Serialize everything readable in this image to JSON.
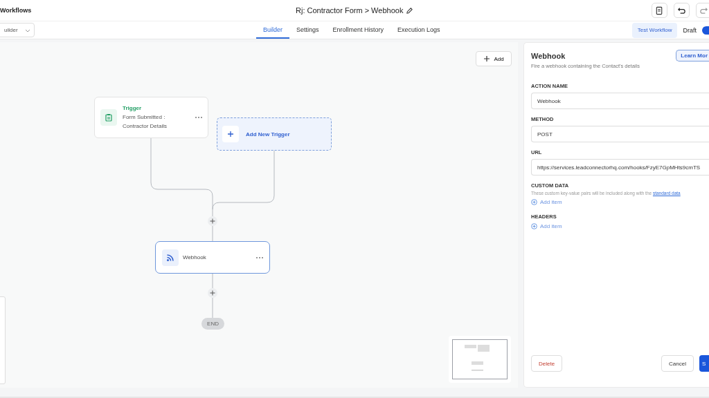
{
  "header": {
    "app_title": "Workflows",
    "workflow_title": "Rj: Contractor Form > Webhook"
  },
  "view_select": {
    "value": "uilder"
  },
  "tabs": [
    {
      "label": "Builder",
      "selected": true
    },
    {
      "label": "Settings",
      "selected": false
    },
    {
      "label": "Enrollment History",
      "selected": false
    },
    {
      "label": "Execution Logs",
      "selected": false
    }
  ],
  "test_button": "Test Workflow",
  "draft": {
    "label": "Draft",
    "on": true
  },
  "canvas": {
    "add_button": "Add",
    "trigger": {
      "title": "Trigger",
      "subtitle": "Form Submitted : Contractor Details"
    },
    "add_trigger": "Add New Trigger",
    "action": {
      "label": "Webhook",
      "selected": true
    },
    "end": "END"
  },
  "panel": {
    "title": "Webhook",
    "learn_more": "Learn Mor",
    "description": "Fire a webhook containing the Contact's details",
    "fields": [
      {
        "label": "ACTION NAME",
        "value": "Webhook"
      },
      {
        "label": "METHOD",
        "value": "POST"
      },
      {
        "label": "URL",
        "value": "https://services.leadconnectorhq.com/hooks/FzyE7GpMHts9cmTS"
      }
    ],
    "sections": [
      {
        "title": "CUSTOM DATA",
        "description": "These custom key-value pairs will be included along with the",
        "link": "standard data",
        "add": "Add item"
      },
      {
        "title": "HEADERS",
        "add": "Add item"
      }
    ],
    "delete_button": "Delete",
    "cancel_button": "Cancel",
    "save_button": "S"
  }
}
